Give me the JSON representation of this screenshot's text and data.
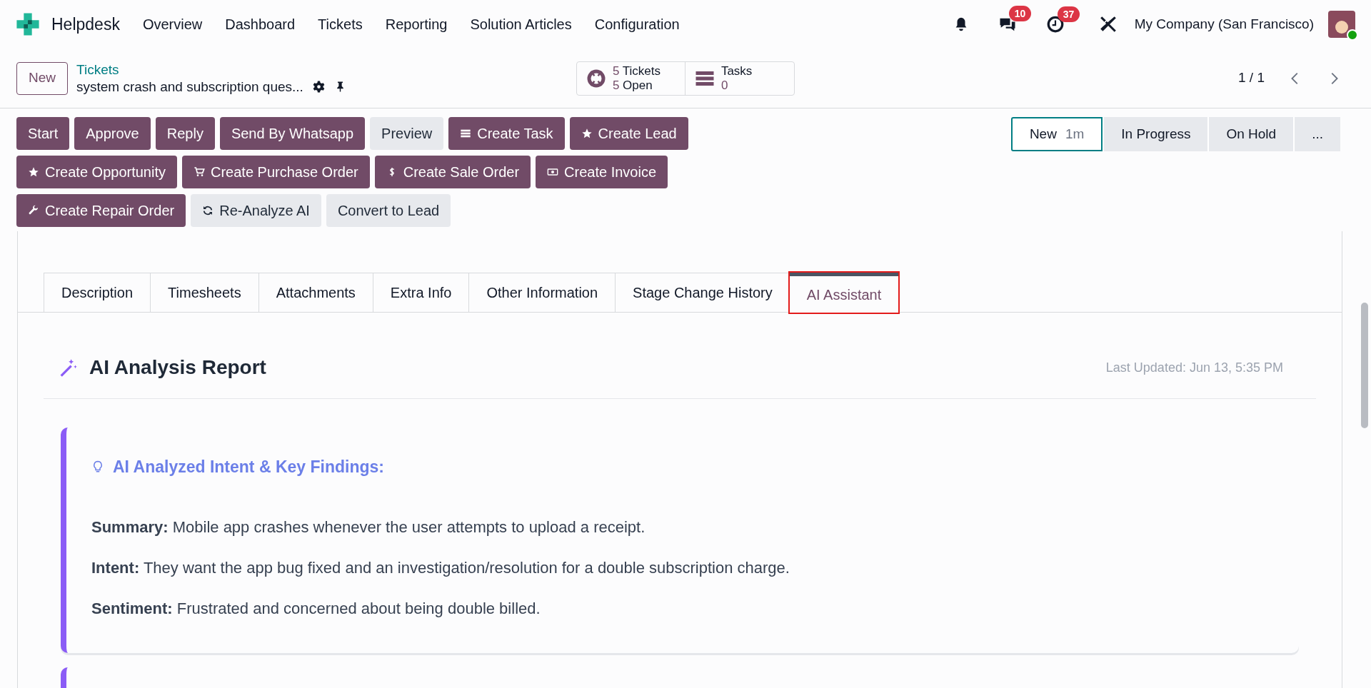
{
  "nav": {
    "app_name": "Helpdesk",
    "menu": [
      "Overview",
      "Dashboard",
      "Tickets",
      "Reporting",
      "Solution Articles",
      "Configuration"
    ]
  },
  "systray": {
    "messages_count": "10",
    "activities_count": "37",
    "company": "My Company (San Francisco)",
    "user_online": true
  },
  "control_panel": {
    "new_button": "New",
    "breadcrumb": "Tickets",
    "record_title": "system crash and subscription ques...",
    "smart_buttons": [
      {
        "kind": "counts",
        "lines": [
          "5 Tickets",
          "5 Open"
        ]
      },
      {
        "kind": "stat",
        "label": "Tasks",
        "value": "0"
      }
    ],
    "pager": "1 / 1"
  },
  "action_buttons": [
    {
      "label": "Start",
      "kind": "primary"
    },
    {
      "label": "Approve",
      "kind": "primary"
    },
    {
      "label": "Reply",
      "kind": "primary"
    },
    {
      "label": "Send By Whatsapp",
      "kind": "primary"
    },
    {
      "label": "Preview",
      "kind": "secondary"
    },
    {
      "label": "Create Task",
      "kind": "primary"
    },
    {
      "label": "Create Lead",
      "kind": "primary"
    },
    {
      "label": "Create Opportunity",
      "kind": "primary"
    },
    {
      "label": "Create Purchase Order",
      "kind": "primary"
    },
    {
      "label": "Create Sale Order",
      "kind": "primary"
    },
    {
      "label": "Create Invoice",
      "kind": "primary"
    },
    {
      "label": "Create Repair Order",
      "kind": "primary"
    },
    {
      "label": "Re-Analyze AI",
      "kind": "secondary"
    },
    {
      "label": "Convert to Lead",
      "kind": "secondary"
    }
  ],
  "stages": [
    {
      "label": "New",
      "duration": "1m",
      "selected": true
    },
    {
      "label": "In Progress",
      "selected": false
    },
    {
      "label": "On Hold",
      "selected": false
    },
    {
      "label": "...",
      "selected": false
    }
  ],
  "tabs": [
    {
      "label": "Description",
      "selected": false
    },
    {
      "label": "Timesheets",
      "selected": false
    },
    {
      "label": "Attachments",
      "selected": false
    },
    {
      "label": "Extra Info",
      "selected": false
    },
    {
      "label": "Other Information",
      "selected": false
    },
    {
      "label": "Stage Change History",
      "selected": false
    },
    {
      "label": "AI Assistant",
      "selected": true
    }
  ],
  "report": {
    "title": "AI Analysis Report",
    "last_updated": "Last Updated: Jun 13, 5:35 PM",
    "cards": [
      {
        "heading": "AI Analyzed Intent & Key Findings:",
        "items": [
          "**Summary:** Mobile app crashes whenever the user attempts to upload a receipt.",
          "**Intent:** They want the app bug fixed and an investigation/resolution for a double subscription charge.",
          "**Sentiment:** Frustrated and concerned about being double billed."
        ]
      }
    ]
  }
}
